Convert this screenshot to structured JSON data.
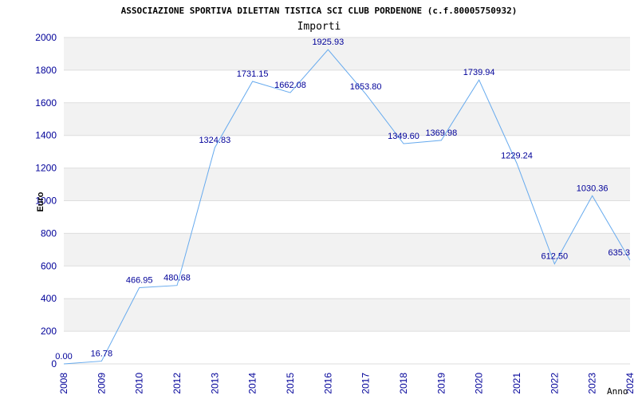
{
  "chart_data": {
    "type": "line",
    "title": "ASSOCIAZIONE SPORTIVA DILETTAN TISTICA SCI CLUB PORDENONE (c.f.80005750932)",
    "subtitle": "Importi",
    "ylabel": "Euro",
    "xlabel": "Anno",
    "ylim": [
      0,
      2000
    ],
    "yticks": [
      0,
      200,
      400,
      600,
      800,
      1000,
      1200,
      1400,
      1600,
      1800,
      2000
    ],
    "grid": true,
    "categories": [
      "2008",
      "2009",
      "2010",
      "2012",
      "2013",
      "2014",
      "2015",
      "2016",
      "2017",
      "2018",
      "2019",
      "2020",
      "2021",
      "2022",
      "2023",
      "2024"
    ],
    "values": [
      0,
      16.78,
      466.95,
      480.68,
      1324.83,
      1731.15,
      1662.08,
      1925.93,
      1653.8,
      1349.6,
      1369.98,
      1739.94,
      1229.24,
      612.5,
      1030.36,
      635.3
    ],
    "data_labels": [
      "0.00",
      "16.78",
      "466.95",
      "480.68",
      "1324.83",
      "1731.15",
      "1662.08",
      "1925.93",
      "1653.80",
      "1349.60",
      "1369.98",
      "1739.94",
      "1229.24",
      "612.50",
      "1030.36",
      "635.3"
    ],
    "line_color": "#66aaee",
    "band_color": "#f2f2f2",
    "text_color": "#000099"
  }
}
